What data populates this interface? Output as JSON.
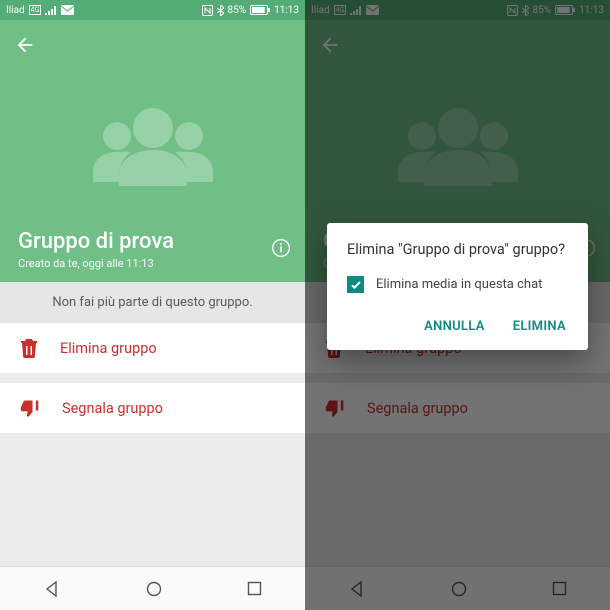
{
  "statusbar": {
    "carrier": "Iliad",
    "net_badge": "4G",
    "battery_pct": "85%",
    "time": "11:13"
  },
  "header": {
    "title": "Gruppo di prova",
    "subtitle": "Creato da te, oggi alle 11:13"
  },
  "banner": {
    "text": "Non fai più parte di questo gruppo."
  },
  "actions": {
    "delete": "Elimina gruppo",
    "report": "Segnala gruppo"
  },
  "dialog": {
    "title": "Elimina \"Gruppo di prova\" gruppo?",
    "checkbox_label": "Elimina media in questa chat",
    "cancel": "ANNULLA",
    "confirm": "ELIMINA"
  }
}
